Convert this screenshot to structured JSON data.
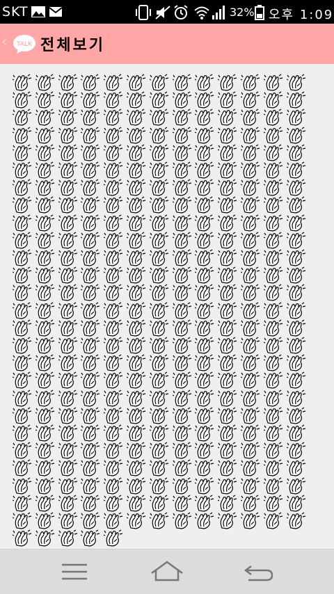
{
  "status_bar": {
    "carrier": "SKT",
    "battery_percent": "32%",
    "time": "오후 1:09",
    "icons": [
      "image-icon",
      "mail-icon",
      "phone-vibrate-icon",
      "mute-icon",
      "alarm-icon",
      "wifi-icon",
      "signal-icon",
      "battery-icon"
    ]
  },
  "app_bar": {
    "title": "전체보기",
    "talk_badge": "TALK",
    "back_icon": "chevron-left-icon"
  },
  "content": {
    "emoji_name": "clapping-hands-icon",
    "full_rows": 26,
    "columns": 13,
    "last_row_count": 5
  },
  "nav_bar": {
    "icons": [
      "menu-icon",
      "home-icon",
      "back-icon"
    ]
  }
}
